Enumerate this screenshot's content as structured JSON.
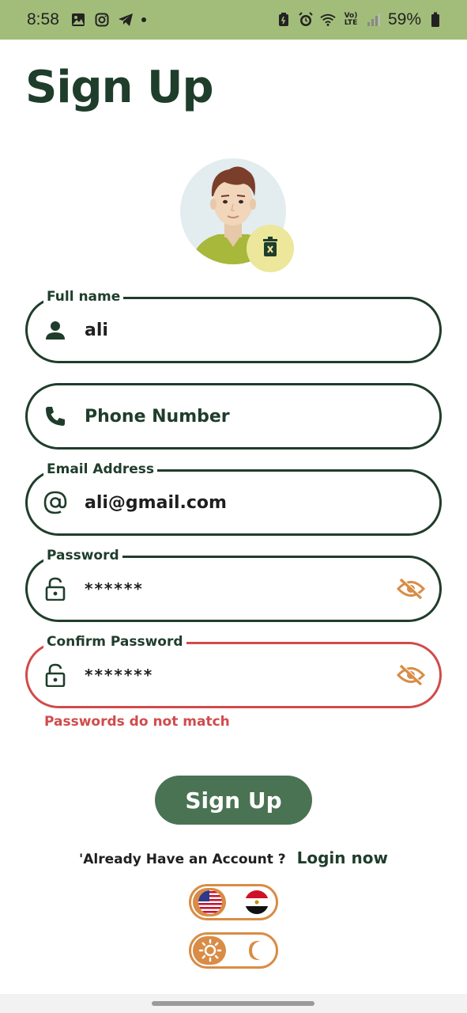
{
  "status_bar": {
    "time": "8:58",
    "battery_percent": "59%",
    "network_label": "Vo) LTE"
  },
  "page": {
    "title": "Sign Up"
  },
  "form": {
    "full_name": {
      "legend": "Full name",
      "value": "ali",
      "icon": "person-icon"
    },
    "phone": {
      "placeholder": "Phone Number",
      "value": "",
      "icon": "phone-icon"
    },
    "email": {
      "legend": "Email Address",
      "value": "ali@gmail.com",
      "icon": "at-icon"
    },
    "password": {
      "legend": "Password",
      "value": "******",
      "icon": "lock-icon"
    },
    "confirm_password": {
      "legend": "Confirm Password",
      "value": "*******",
      "icon": "lock-icon",
      "error": "Passwords do not match"
    }
  },
  "actions": {
    "signup_label": "Sign Up",
    "login_prompt": "'Already Have an Account ?",
    "login_link": "Login now"
  },
  "toggles": {
    "language": {
      "selected": "en",
      "options": [
        "us-flag-icon",
        "egypt-flag-icon"
      ]
    },
    "theme": {
      "selected": "light",
      "options": [
        "sun-icon",
        "moon-icon"
      ]
    }
  },
  "colors": {
    "primary": "#1f3d2b",
    "button": "#4a7353",
    "error": "#d14b4b",
    "accent": "#d98c45",
    "status_bar": "#a2bd7a",
    "avatar_delete_bg": "#ece79a"
  }
}
